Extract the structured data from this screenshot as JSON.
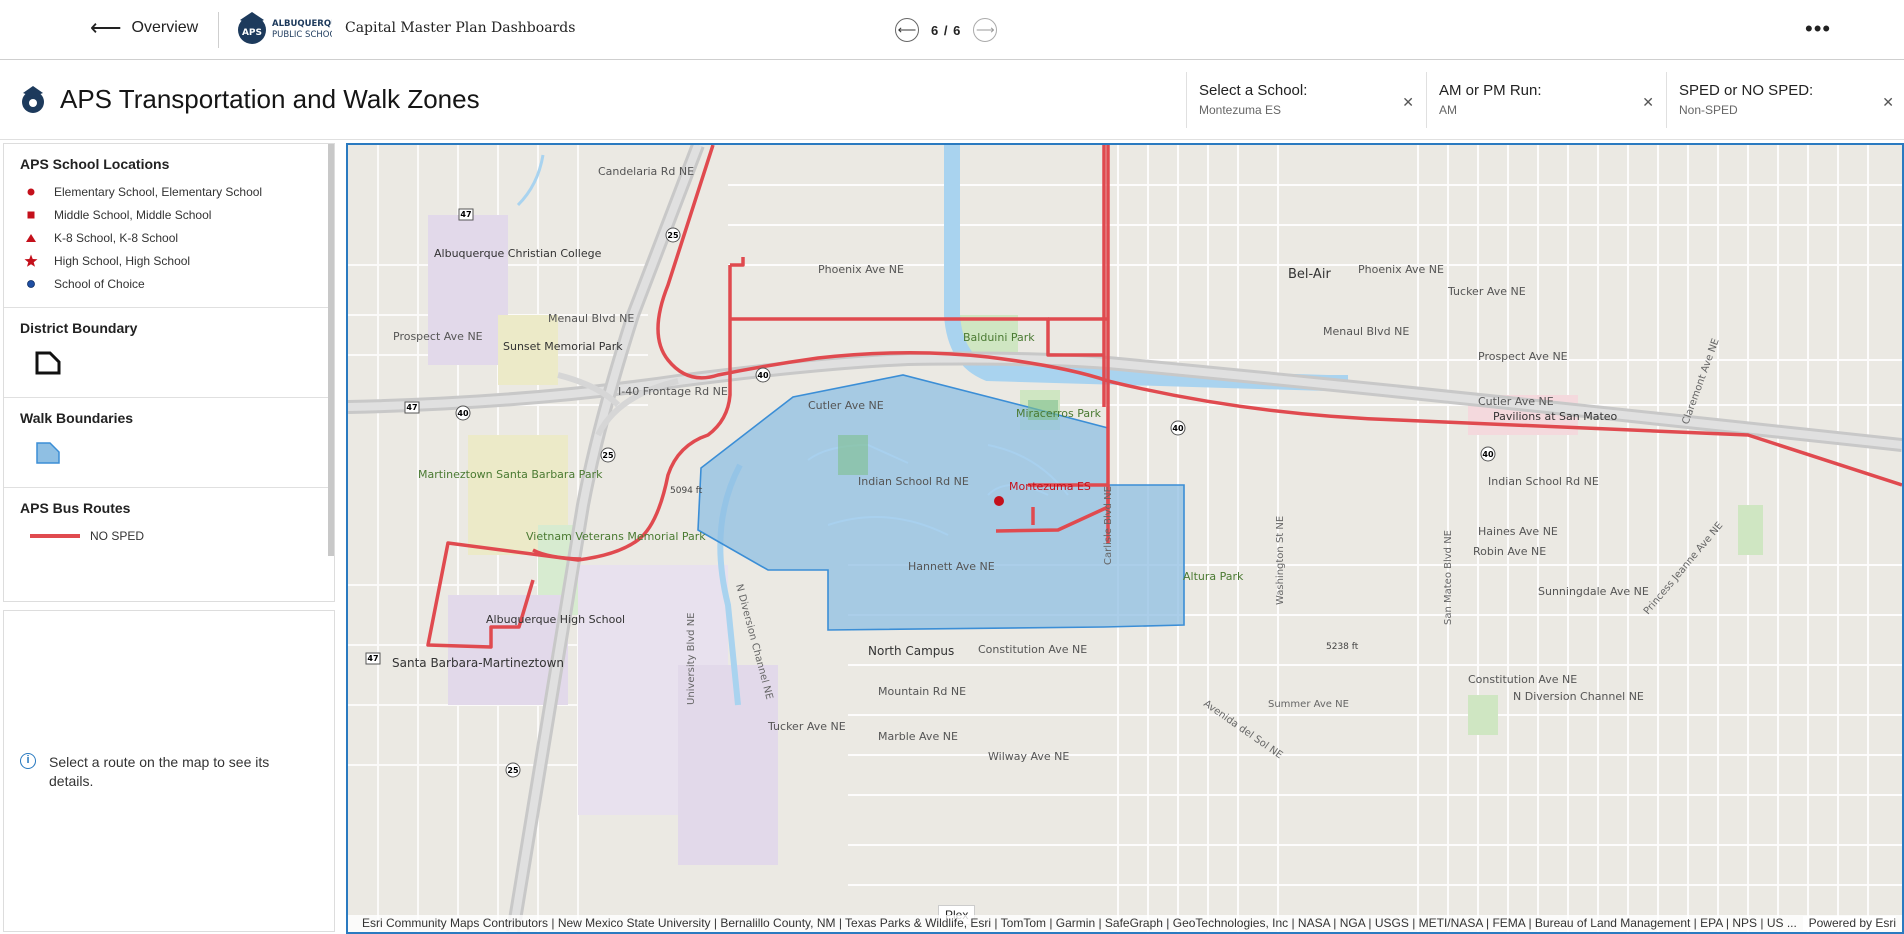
{
  "topbar": {
    "back_label": "Overview",
    "org_name_line1": "ALBUQUERQUE",
    "org_name_line2": "PUBLIC SCHOOLS",
    "dashboard_title": "Capital Master Plan Dashboards",
    "pager": "6  /  6",
    "more_label": "•••"
  },
  "header": {
    "title": "APS Transportation and Walk Zones",
    "selectors": [
      {
        "label": "Select a School:",
        "value": "Montezuma ES"
      },
      {
        "label": "AM or PM Run:",
        "value": "AM"
      },
      {
        "label": "SPED or NO SPED:",
        "value": "Non-SPED"
      }
    ]
  },
  "legend": {
    "locations": {
      "title": "APS School Locations",
      "items": [
        {
          "label": "Elementary School, Elementary School",
          "symbol": "circle"
        },
        {
          "label": "Middle School, Middle School",
          "symbol": "square"
        },
        {
          "label": "K-8 School, K-8 School",
          "symbol": "triangle"
        },
        {
          "label": "High School, High School",
          "symbol": "star"
        },
        {
          "label": "School of Choice",
          "symbol": "blue-circle"
        }
      ]
    },
    "district_boundary": {
      "title": "District Boundary"
    },
    "walk_boundaries": {
      "title": "Walk Boundaries"
    },
    "bus_routes": {
      "title": "APS Bus Routes",
      "items": [
        {
          "label": "NO SPED"
        }
      ]
    }
  },
  "info": {
    "text": "Select a route on the map to see its details."
  },
  "colors": {
    "route": "#e04a4f",
    "walk_fill": "#8fbfe3",
    "walk_stroke": "#3b8ed6",
    "accent": "#2a7ac0",
    "school_marker": "#c4101b"
  },
  "map": {
    "school_label": "Montezuma ES",
    "tooltip": "Plex",
    "attribution": "Esri Community Maps Contributors | New Mexico State University | Bernalillo County, NM | Texas Parks & Wildlife, Esri | TomTom | Garmin | SafeGraph | GeoTechnologies, Inc | NASA | NGA | USGS | METI/NASA | FEMA | Bureau of Land Management | EPA | NPS | US ...",
    "powered_by": "Powered by Esri",
    "places": [
      "Candelaria Rd NE",
      "Phoenix Ave NE",
      "Menaul Blvd NE",
      "Prospect Ave NE",
      "Cutler Ave NE",
      "Indian School Rd NE",
      "Hannett Ave NE",
      "Constitution Ave NE",
      "Mountain Rd NE",
      "Marble Ave NE",
      "Bel-Air",
      "Balduini Park",
      "Miracerros Park",
      "Altura Park",
      "North Campus",
      "Albuquerque Christian College",
      "Sunset Memorial Park",
      "Martineztown Santa Barbara Park",
      "Vietnam Veterans Memorial Park",
      "Albuquerque High School",
      "Santa Barbara-Martineztown",
      "Pavilions at San Mateo",
      "Carlisle Blvd NE",
      "Washington St NE",
      "San Mateo Blvd NE",
      "University Blvd NE",
      "N Diversion Channel NE",
      "Avenida del Sol NE",
      "Summer Ave NE",
      "Haines Ave NE",
      "Robin Ave NE",
      "Sunningdale Ave NE",
      "Princess Jeanne Ave NE",
      "Claremont Ave NE",
      "Wilway Ave NE",
      "Tucker Ave NE",
      "I-40 Frontage Rd NE",
      "5094 ft",
      "5238 ft"
    ]
  }
}
